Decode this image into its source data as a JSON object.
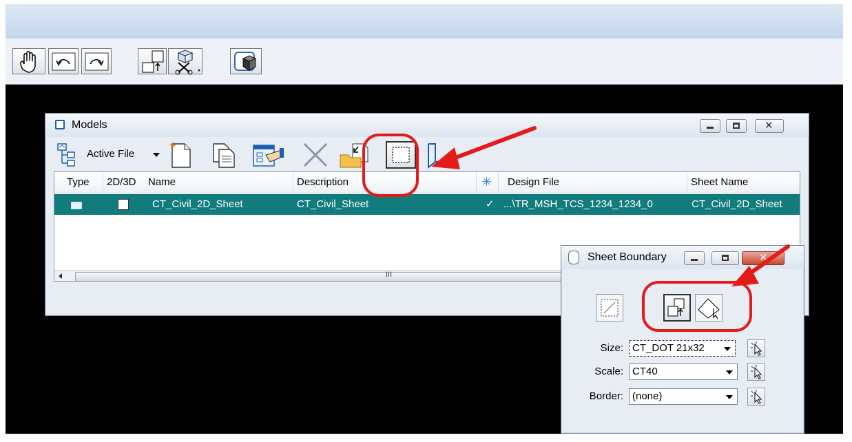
{
  "toolbar": {
    "icons": [
      "pan-hand-icon",
      "view-previous-icon",
      "view-next-icon",
      "copy-view-icon",
      "cut-cube-icon",
      "render-cube-icon"
    ]
  },
  "models_dialog": {
    "title": "Models",
    "active_file_label": "Active File",
    "columns": [
      "Type",
      "2D/3D",
      "Name",
      "Description",
      "Design File",
      "Sheet Name"
    ],
    "rows": [
      {
        "name": "CT_Civil_2D_Sheet",
        "description": "CT_Civil_Sheet",
        "check": "✓",
        "design_file": "...\\TR_MSH_TCS_1234_1234_0",
        "sheet_name": "CT_Civil_2D_Sheet"
      }
    ],
    "scroll_mark": "III"
  },
  "sheet_boundary": {
    "title": "Sheet Boundary",
    "size_label": "Size:",
    "size_value": "CT_DOT 21x32",
    "scale_label": "Scale:",
    "scale_value": "CT40",
    "border_label": "Border:",
    "border_value": "(none)"
  },
  "colors": {
    "selection": "#127c7c",
    "annotation": "#e31b1b",
    "window": "#e8edf3"
  }
}
